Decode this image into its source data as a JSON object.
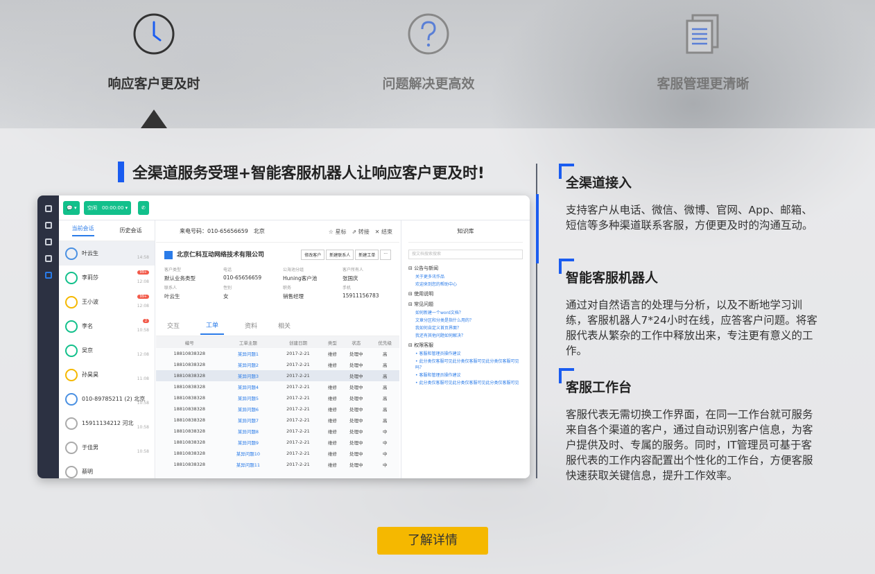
{
  "tabs": [
    {
      "label": "响应客户更及时",
      "icon": "clock-icon"
    },
    {
      "label": "问题解决更高效",
      "icon": "question-icon"
    },
    {
      "label": "客服管理更清晰",
      "icon": "documents-icon"
    }
  ],
  "headline": "全渠道服务受理+智能客服机器人让响应客户更及时!",
  "app": {
    "status_btn": "空闲",
    "timer": "00:00:00",
    "conv_tabs": [
      "当前会话",
      "历史会话"
    ],
    "conversations": [
      {
        "name": "叶云生",
        "time": "14:58",
        "color": "#4a90e2"
      },
      {
        "name": "李莉莎",
        "time": "12:08",
        "badge": "99+",
        "color": "#12c08b"
      },
      {
        "name": "王小波",
        "time": "12:08",
        "badge": "99+",
        "color": "#f5b800"
      },
      {
        "name": "李名",
        "time": "10:58",
        "badge": "2",
        "color": "#12c08b"
      },
      {
        "name": "吴京",
        "time": "12:08",
        "color": "#12c08b"
      },
      {
        "name": "孙昊昊",
        "time": "11:08",
        "color": "#f5b800"
      },
      {
        "name": "010-89785211 (2) 北京",
        "time": "10:58",
        "color": "#4a90e2"
      },
      {
        "name": "15911134212 河北",
        "time": "10:58",
        "color": "#aaa"
      },
      {
        "name": "于佳男",
        "time": "10:58",
        "color": "#aaa"
      },
      {
        "name": "蔡明",
        "time": "",
        "color": "#aaa"
      }
    ],
    "call_label": "来电号码：010-65656659　北京",
    "actions": "☆ 星标　⇗ 转接　✕ 结束",
    "company": "北京仁科互动网络技术有限公司",
    "company_btns": [
      "修改客户",
      "新建联系人",
      "新建工单"
    ],
    "fields": [
      {
        "k": "客户类型",
        "v": "默认业务类型"
      },
      {
        "k": "电话",
        "v": "010-65656659"
      },
      {
        "k": "公海池分组",
        "v": "Huning客户池"
      },
      {
        "k": "客户所有人",
        "v": "张国庆"
      },
      {
        "k": "联系人",
        "v": "叶云生"
      },
      {
        "k": "性别",
        "v": "女"
      },
      {
        "k": "职务",
        "v": "销售经理"
      },
      {
        "k": "手机",
        "v": "15911156783"
      }
    ],
    "detail_tabs": [
      "交互",
      "工单",
      "资料",
      "相关"
    ],
    "table_headers": [
      "编号",
      "工单主题",
      "创建日期",
      "类型",
      "状态",
      "优先级"
    ],
    "rows": [
      [
        "18810838328",
        "某异问题1",
        "2017-2-21",
        "维修",
        "处理中",
        "高"
      ],
      [
        "18810838328",
        "某异问题2",
        "2017-2-21",
        "维修",
        "处理中",
        "高"
      ],
      [
        "18810838328",
        "某异问题3",
        "2017-2-21",
        "",
        "处理中",
        "高"
      ],
      [
        "18810838328",
        "某异问题4",
        "2017-2-21",
        "维修",
        "处理中",
        "高"
      ],
      [
        "18810838328",
        "某异问题5",
        "2017-2-21",
        "维修",
        "处理中",
        "高"
      ],
      [
        "18810838328",
        "某异问题6",
        "2017-2-21",
        "维修",
        "处理中",
        "高"
      ],
      [
        "18810838328",
        "某异问题7",
        "2017-2-21",
        "维修",
        "处理中",
        "高"
      ],
      [
        "18810838328",
        "某异问题8",
        "2017-2-21",
        "维修",
        "处理中",
        "中"
      ],
      [
        "18810838328",
        "某异问题9",
        "2017-2-21",
        "维修",
        "处理中",
        "中"
      ],
      [
        "18810838328",
        "某异问题10",
        "2017-2-21",
        "维修",
        "处理中",
        "中"
      ],
      [
        "18810838328",
        "某异问题11",
        "2017-2-21",
        "维修",
        "处理中",
        "中"
      ]
    ],
    "kb_title": "知识库",
    "kb_search": "搜文档搜索搜索",
    "kb_sections": [
      {
        "title": "公告与新闻",
        "items": [
          "关于更多讯作品",
          "欢迎来到您的帮助中心"
        ]
      },
      {
        "title": "使用说明",
        "items": []
      },
      {
        "title": "常见问题",
        "items": [
          "如何新建一个word文档？",
          "文章分区和分类是指什么用的？",
          "我如何自定义首页界面？",
          "我还有其他问题如何解决？"
        ]
      },
      {
        "title": "权限客服",
        "items": [
          "• 客服和管理员操作建议",
          "• 此分类仅客服可见此分类仅客服可见此分类仅客服可见吗？",
          "• 客服和管理员操作建议",
          "• 此分类仅客服可见此分类仅客服可见此分类仅客服可见"
        ]
      }
    ]
  },
  "features": [
    {
      "title": "全渠道接入",
      "desc": "支持客户从电话、微信、微博、官网、App、邮箱、短信等多种渠道联系客服，方便更及时的沟通互动。"
    },
    {
      "title": "智能客服机器人",
      "desc": "通过对自然语言的处理与分析，以及不断地学习训练，客服机器人7*24小时在线，应答客户问题。将客服代表从繁杂的工作中释放出来，专注更有意义的工作。"
    },
    {
      "title": "客服工作台",
      "desc": "客服代表无需切换工作界面，在同一工作台就可服务来自各个渠道的客户，通过自动识别客户信息，为客户提供及时、专属的服务。同时，IT管理员可基于客服代表的工作内容配置出个性化的工作台，方便客服快速获取关键信息，提升工作效率。"
    }
  ],
  "cta": "了解详情",
  "colors": {
    "accent": "#1a5cf0",
    "cta": "#f5b800",
    "green": "#12c08b"
  }
}
